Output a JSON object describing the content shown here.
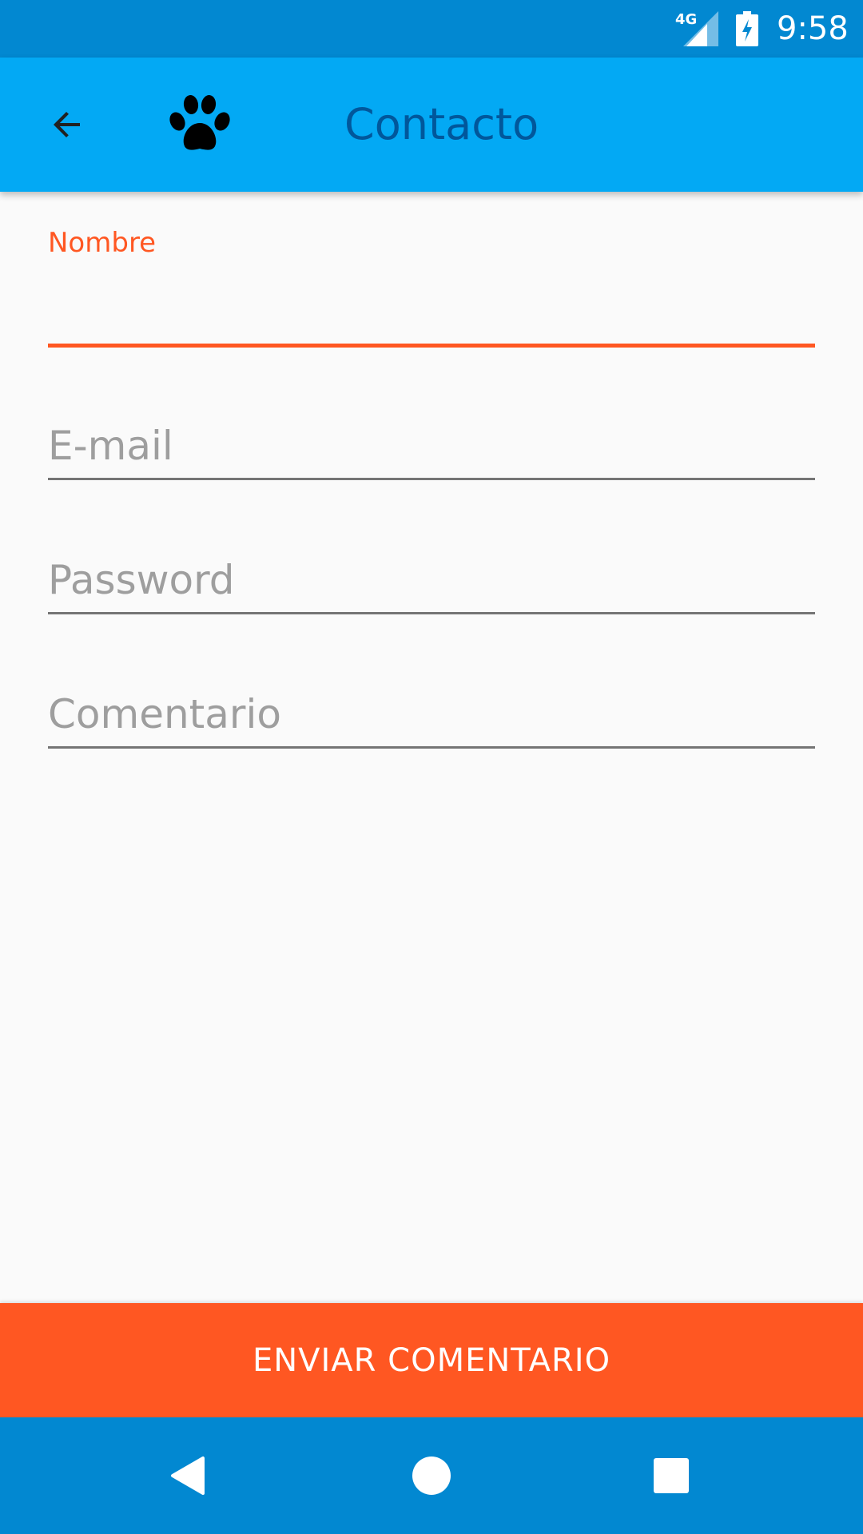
{
  "status_bar": {
    "network_label": "4G",
    "time": "9:58",
    "icons": [
      "signal-icon",
      "battery-charging-icon"
    ]
  },
  "app_bar": {
    "title": "Contacto",
    "icons": [
      "arrow-back-icon",
      "paw-icon"
    ]
  },
  "form": {
    "nombre": {
      "label": "Nombre",
      "value": "",
      "focused": true
    },
    "email": {
      "placeholder": "E-mail",
      "value": ""
    },
    "password": {
      "placeholder": "Password",
      "value": ""
    },
    "comentario": {
      "placeholder": "Comentario",
      "value": ""
    }
  },
  "submit": {
    "label": "ENVIAR COMENTARIO"
  },
  "nav_bar": {
    "icons": [
      "nav-back-icon",
      "nav-home-icon",
      "nav-recents-icon"
    ]
  },
  "colors": {
    "status_bar": "#0288D1",
    "app_bar": "#03A9F4",
    "title": "#01579B",
    "accent": "#FF5722",
    "background": "#FAFAFA",
    "hint": "#9E9E9E",
    "underline": "#757575"
  }
}
